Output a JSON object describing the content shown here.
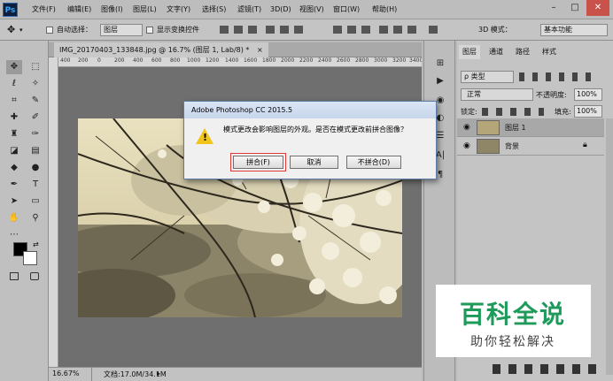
{
  "menubar": {
    "logo": "Ps",
    "items": [
      "文件(F)",
      "编辑(E)",
      "图像(I)",
      "图层(L)",
      "文字(Y)",
      "选择(S)",
      "滤镜(T)",
      "3D(D)",
      "视图(V)",
      "窗口(W)",
      "帮助(H)"
    ],
    "window_controls": [
      "–",
      "□",
      "✕"
    ]
  },
  "options": {
    "auto_select_label": "自动选择：",
    "auto_select_value": "图层",
    "show_transform_label": "显示变换控件",
    "mode_3d_label": "3D 模式：",
    "workspace": "基本功能"
  },
  "document": {
    "tab_label": "IMG_20170403_133848.jpg @ 16.7% (图层 1, Lab/8) *",
    "tab_close": "×",
    "ruler_ticks": [
      "400",
      "200",
      "0",
      "200",
      "400",
      "600",
      "800",
      "1000",
      "1200",
      "1400",
      "1600",
      "1800",
      "2000",
      "2200",
      "2400",
      "2600",
      "2800",
      "3000",
      "3200",
      "3400"
    ]
  },
  "status": {
    "zoom": "16.67%",
    "doc_info": "文档:17.0M/34.1M"
  },
  "layers_panel": {
    "tabs": [
      "图层",
      "通道",
      "路径",
      "样式"
    ],
    "filter_label": "ρ 类型",
    "blend_mode": "正常",
    "opacity_label": "不透明度:",
    "opacity_value": "100%",
    "lock_label": "锁定:",
    "fill_label": "填充:",
    "fill_value": "100%",
    "layers": [
      {
        "name": "图层 1",
        "selected": true
      },
      {
        "name": "背景",
        "selected": false
      }
    ]
  },
  "dialog": {
    "title": "Adobe Photoshop CC 2015.5",
    "message": "模式更改会影响图层的外观。是否在模式更改前拼合图像？",
    "buttons": {
      "flatten": "拼合(F)",
      "cancel": "取消",
      "dont_flatten": "不拼合(D)"
    },
    "warning_icon": "warning-icon"
  },
  "watermark": {
    "title": "百科全说",
    "subtitle": "助你轻松解决"
  }
}
